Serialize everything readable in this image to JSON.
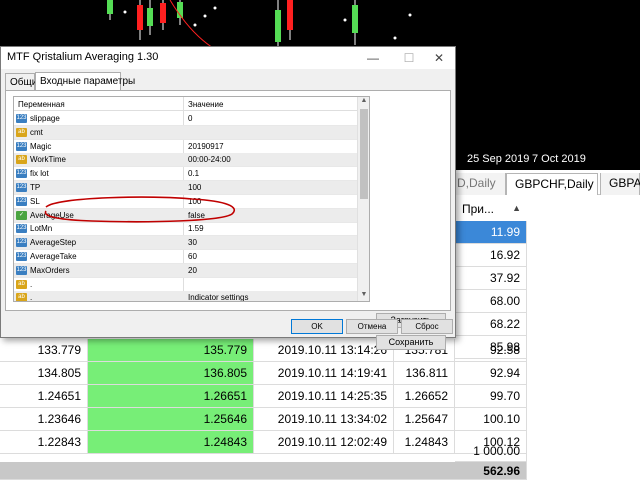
{
  "dialog": {
    "title": "MTF Qristalium Averaging 1.30",
    "controls": {
      "minimize": "—",
      "maximize": "☐",
      "close": "✕"
    },
    "tabs": [
      {
        "label": "Общие"
      },
      {
        "label": "Входные параметры"
      }
    ],
    "params_header": {
      "name": "Переменная",
      "value": "Значение"
    },
    "params": [
      {
        "icon": "number-param-icon",
        "name": "slippage",
        "value": "0"
      },
      {
        "icon": "string-param-icon",
        "name": "cmt",
        "value": ""
      },
      {
        "icon": "number-param-icon",
        "name": "Magic",
        "value": "20190917"
      },
      {
        "icon": "string-param-icon",
        "name": "WorkTime",
        "value": "00:00-24:00"
      },
      {
        "icon": "number-param-icon",
        "name": "fix lot",
        "value": "0.1"
      },
      {
        "icon": "number-param-icon",
        "name": "TP",
        "value": "100"
      },
      {
        "icon": "number-param-icon",
        "name": "SL",
        "value": "100"
      },
      {
        "icon": "bool-param-icon",
        "name": "AverageUse",
        "value": "false"
      },
      {
        "icon": "number-param-icon",
        "name": "LotMn",
        "value": "1.59"
      },
      {
        "icon": "number-param-icon",
        "name": "AverageStep",
        "value": "30"
      },
      {
        "icon": "number-param-icon",
        "name": "AverageTake",
        "value": "60"
      },
      {
        "icon": "number-param-icon",
        "name": "MaxOrders",
        "value": "20"
      },
      {
        "icon": "string-param-icon",
        "name": ".",
        "value": ""
      },
      {
        "icon": "string-param-icon",
        "name": ".",
        "value": "Indicator settings"
      }
    ],
    "side_buttons": {
      "load": "Загрузить",
      "save": "Сохранить"
    },
    "buttons": {
      "ok": "OK",
      "cancel": "Отмена",
      "reset": "Сброс"
    }
  },
  "chart": {
    "dates": [
      "25 Sep 2019",
      "7 Oct 2019"
    ]
  },
  "symbol_tabs": [
    {
      "label": "D,Daily"
    },
    {
      "label": "GBPCHF,Daily"
    },
    {
      "label": "GBPA"
    }
  ],
  "table": {
    "header_price": "При...",
    "sort_arrow": "▲",
    "top_values": [
      "11.99",
      "16.92",
      "37.92",
      "68.00",
      "68.22",
      "85.98"
    ],
    "rows": [
      {
        "open": "133.779",
        "current": "135.779",
        "time": "2019.10.11 13:14:26",
        "close": "135.781",
        "profit": "92.58"
      },
      {
        "open": "134.805",
        "current": "136.805",
        "time": "2019.10.11 14:19:41",
        "close": "136.811",
        "profit": "92.94"
      },
      {
        "open": "1.24651",
        "current": "1.26651",
        "time": "2019.10.11 14:25:35",
        "close": "1.26652",
        "profit": "99.70"
      },
      {
        "open": "1.23646",
        "current": "1.25646",
        "time": "2019.10.11 13:34:02",
        "close": "1.25647",
        "profit": "100.10"
      },
      {
        "open": "1.22843",
        "current": "1.24843",
        "time": "2019.10.11 12:02:49",
        "close": "1.24843",
        "profit": "100.12"
      }
    ],
    "extra_value": "1 000.00",
    "total": "562.96"
  },
  "colors": {
    "chart_bg": "#000000",
    "bull_candle": "#55dd55",
    "bear_candle": "#ff2020",
    "highlight_green": "#77ee77",
    "selection_blue": "#3b88d8",
    "annotation_red": "#c00000"
  }
}
